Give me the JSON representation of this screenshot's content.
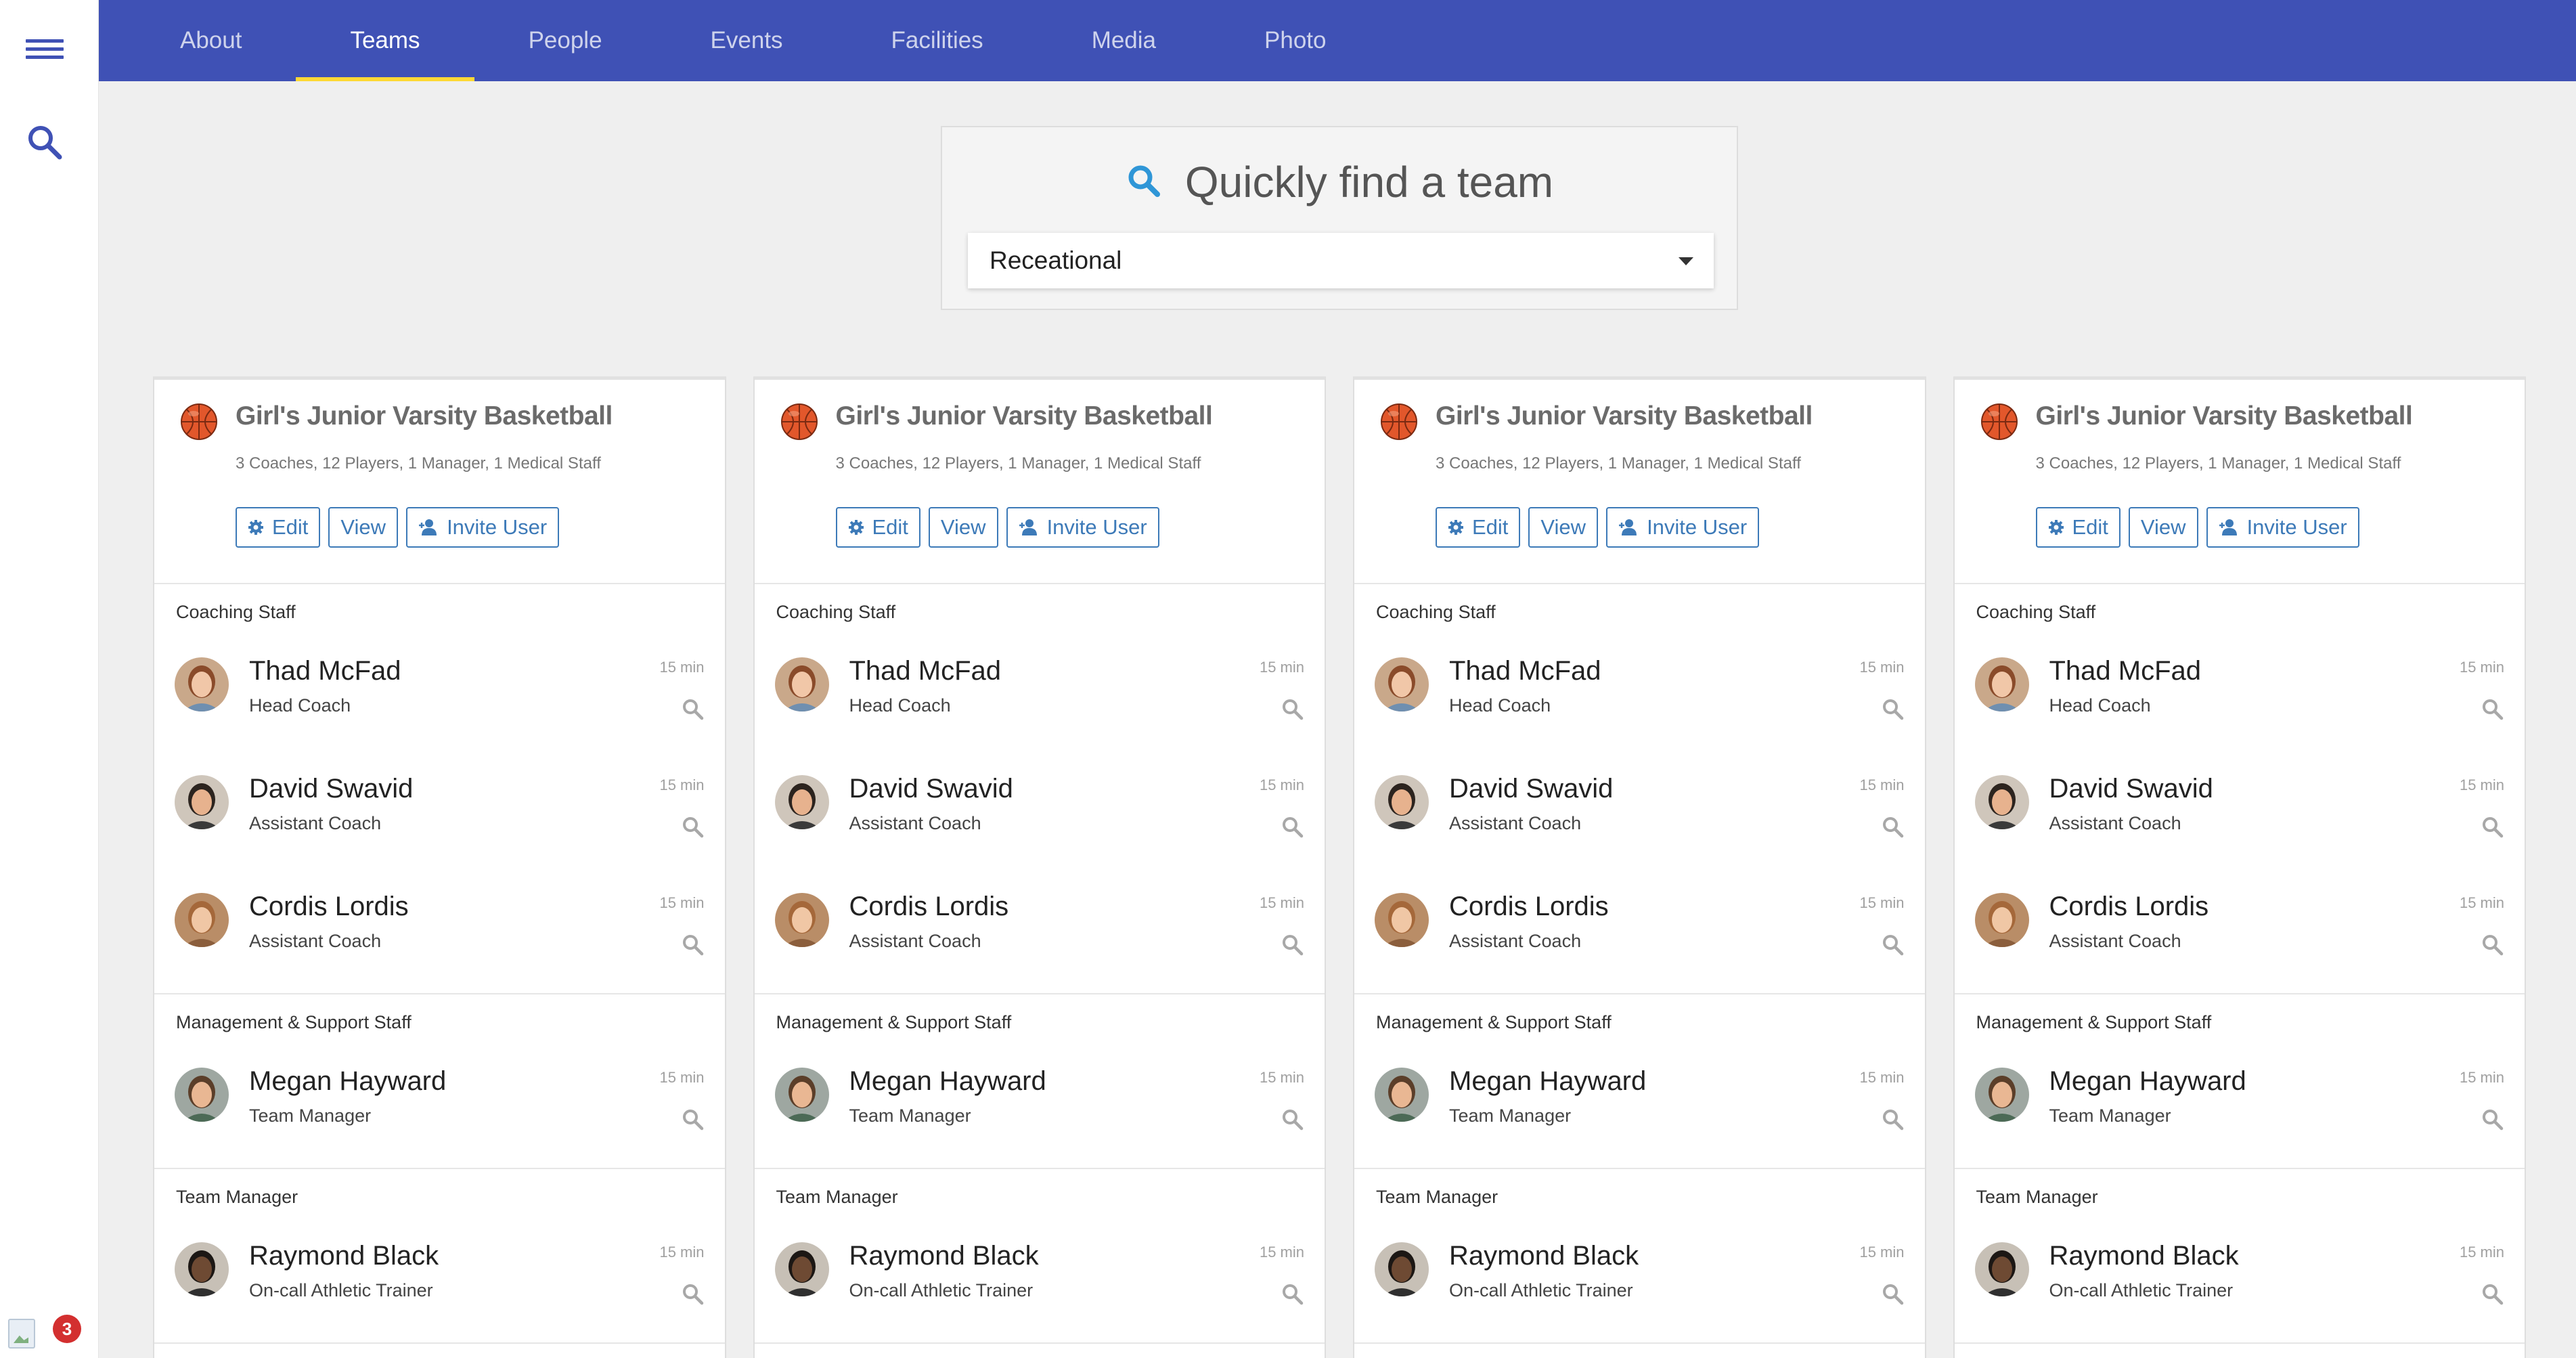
{
  "nav": {
    "tabs": [
      {
        "label": "About"
      },
      {
        "label": "Teams"
      },
      {
        "label": "People"
      },
      {
        "label": "Events"
      },
      {
        "label": "Facilities"
      },
      {
        "label": "Media"
      },
      {
        "label": "Photo"
      }
    ],
    "active_tab": "Teams"
  },
  "rail": {
    "notification_count": "3"
  },
  "finder": {
    "heading": "Quickly find a team",
    "selected": "Receational"
  },
  "colors": {
    "nav_bg": "#3f51b5",
    "active_indicator": "#fdd835",
    "button_accent": "#3d7ab8",
    "search_icon": "#2f96d7"
  },
  "cards": [
    {
      "title": "Girl's Junior Varsity Basketball",
      "summary": "3 Coaches, 12 Players, 1 Manager, 1 Medical Staff",
      "actions": {
        "edit": "Edit",
        "view": "View",
        "invite": "Invite User"
      },
      "sections": [
        {
          "label": "Coaching Staff",
          "people": [
            {
              "name": "Thad McFad",
              "role": "Head Coach",
              "time": "15 min"
            },
            {
              "name": "David Swavid",
              "role": "Assistant Coach",
              "time": "15 min"
            },
            {
              "name": "Cordis Lordis",
              "role": "Assistant Coach",
              "time": "15 min"
            }
          ]
        },
        {
          "label": "Management & Support Staff",
          "people": [
            {
              "name": "Megan Hayward",
              "role": "Team Manager",
              "time": "15 min"
            }
          ]
        },
        {
          "label": "Team Manager",
          "people": [
            {
              "name": "Raymond Black",
              "role": "On-call Athletic Trainer",
              "time": "15 min"
            }
          ]
        }
      ]
    },
    {
      "title": "Girl's Junior Varsity Basketball",
      "summary": "3 Coaches, 12 Players, 1 Manager, 1 Medical Staff",
      "actions": {
        "edit": "Edit",
        "view": "View",
        "invite": "Invite User"
      },
      "sections": [
        {
          "label": "Coaching Staff",
          "people": [
            {
              "name": "Thad McFad",
              "role": "Head Coach",
              "time": "15 min"
            },
            {
              "name": "David Swavid",
              "role": "Assistant Coach",
              "time": "15 min"
            },
            {
              "name": "Cordis Lordis",
              "role": "Assistant Coach",
              "time": "15 min"
            }
          ]
        },
        {
          "label": "Management & Support Staff",
          "people": [
            {
              "name": "Megan Hayward",
              "role": "Team Manager",
              "time": "15 min"
            }
          ]
        },
        {
          "label": "Team Manager",
          "people": [
            {
              "name": "Raymond Black",
              "role": "On-call Athletic Trainer",
              "time": "15 min"
            }
          ]
        }
      ]
    },
    {
      "title": "Girl's Junior Varsity Basketball",
      "summary": "3 Coaches, 12 Players, 1 Manager, 1 Medical Staff",
      "actions": {
        "edit": "Edit",
        "view": "View",
        "invite": "Invite User"
      },
      "sections": [
        {
          "label": "Coaching Staff",
          "people": [
            {
              "name": "Thad McFad",
              "role": "Head Coach",
              "time": "15 min"
            },
            {
              "name": "David Swavid",
              "role": "Assistant Coach",
              "time": "15 min"
            },
            {
              "name": "Cordis Lordis",
              "role": "Assistant Coach",
              "time": "15 min"
            }
          ]
        },
        {
          "label": "Management & Support Staff",
          "people": [
            {
              "name": "Megan Hayward",
              "role": "Team Manager",
              "time": "15 min"
            }
          ]
        },
        {
          "label": "Team Manager",
          "people": [
            {
              "name": "Raymond Black",
              "role": "On-call Athletic Trainer",
              "time": "15 min"
            }
          ]
        }
      ]
    },
    {
      "title": "Girl's Junior Varsity Basketball",
      "summary": "3 Coaches, 12 Players, 1 Manager, 1 Medical Staff",
      "actions": {
        "edit": "Edit",
        "view": "View",
        "invite": "Invite User"
      },
      "sections": [
        {
          "label": "Coaching Staff",
          "people": [
            {
              "name": "Thad McFad",
              "role": "Head Coach",
              "time": "15 min"
            },
            {
              "name": "David Swavid",
              "role": "Assistant Coach",
              "time": "15 min"
            },
            {
              "name": "Cordis Lordis",
              "role": "Assistant Coach",
              "time": "15 min"
            }
          ]
        },
        {
          "label": "Management & Support Staff",
          "people": [
            {
              "name": "Megan Hayward",
              "role": "Team Manager",
              "time": "15 min"
            }
          ]
        },
        {
          "label": "Team Manager",
          "people": [
            {
              "name": "Raymond Black",
              "role": "On-call Athletic Trainer",
              "time": "15 min"
            }
          ]
        }
      ]
    }
  ]
}
